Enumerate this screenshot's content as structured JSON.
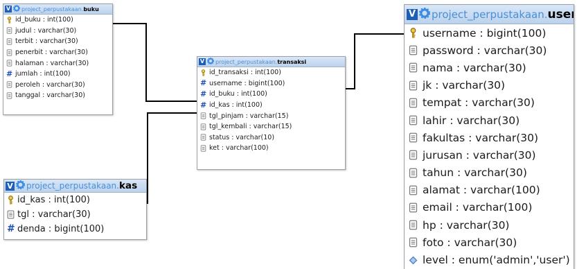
{
  "database": "project_perpustakaan.",
  "tables": {
    "buku": {
      "name": "buku",
      "fields": [
        {
          "icon": "key",
          "text": "id_buku : int(100)"
        },
        {
          "icon": "column",
          "text": "judul : varchar(30)"
        },
        {
          "icon": "column",
          "text": "terbit : varchar(30)"
        },
        {
          "icon": "column",
          "text": "penerbit : varchar(30)"
        },
        {
          "icon": "column",
          "text": "halaman : varchar(30)"
        },
        {
          "icon": "hash",
          "text": "jumlah : int(100)"
        },
        {
          "icon": "column",
          "text": "peroleh : varchar(30)"
        },
        {
          "icon": "column",
          "text": "tanggal : varchar(30)"
        }
      ]
    },
    "transaksi": {
      "name": "transaksi",
      "fields": [
        {
          "icon": "key",
          "text": "id_transaksi : int(100)"
        },
        {
          "icon": "hash",
          "text": "username : bigint(100)"
        },
        {
          "icon": "hash",
          "text": "id_buku : int(100)"
        },
        {
          "icon": "hash",
          "text": "id_kas : int(100)"
        },
        {
          "icon": "column",
          "text": "tgl_pinjam : varchar(15)"
        },
        {
          "icon": "column",
          "text": "tgl_kembali : varchar(15)"
        },
        {
          "icon": "column",
          "text": "status : varchar(10)"
        },
        {
          "icon": "column",
          "text": "ket : varchar(100)"
        }
      ]
    },
    "kas": {
      "name": "kas",
      "fields": [
        {
          "icon": "key",
          "text": "id_kas : int(100)"
        },
        {
          "icon": "column",
          "text": "tgl : varchar(30)"
        },
        {
          "icon": "hash",
          "text": "denda : bigint(100)"
        }
      ]
    },
    "user": {
      "name": "user",
      "fields": [
        {
          "icon": "key",
          "text": "username : bigint(100)"
        },
        {
          "icon": "column",
          "text": "password : varchar(30)"
        },
        {
          "icon": "column",
          "text": "nama : varchar(30)"
        },
        {
          "icon": "column",
          "text": "jk : varchar(30)"
        },
        {
          "icon": "column",
          "text": "tempat : varchar(30)"
        },
        {
          "icon": "column",
          "text": "lahir : varchar(30)"
        },
        {
          "icon": "column",
          "text": "fakultas : varchar(30)"
        },
        {
          "icon": "column",
          "text": "jurusan : varchar(30)"
        },
        {
          "icon": "column",
          "text": "tahun : varchar(30)"
        },
        {
          "icon": "column",
          "text": "alamat : varchar(100)"
        },
        {
          "icon": "column",
          "text": "email : varchar(100)"
        },
        {
          "icon": "column",
          "text": "hp : varchar(30)"
        },
        {
          "icon": "column",
          "text": "foto : varchar(30)"
        },
        {
          "icon": "enum",
          "text": "level : enum('admin','user')"
        }
      ]
    }
  },
  "relations": [
    {
      "from": "transaksi.username",
      "to": "user.username"
    },
    {
      "from": "transaksi.id_buku",
      "to": "buku.id_buku"
    },
    {
      "from": "transaksi.id_kas",
      "to": "kas.id_kas"
    }
  ],
  "colors": {
    "header_db": "#4a8fd6",
    "v_badge": "#1d5fb8",
    "link_line": "#000000"
  }
}
